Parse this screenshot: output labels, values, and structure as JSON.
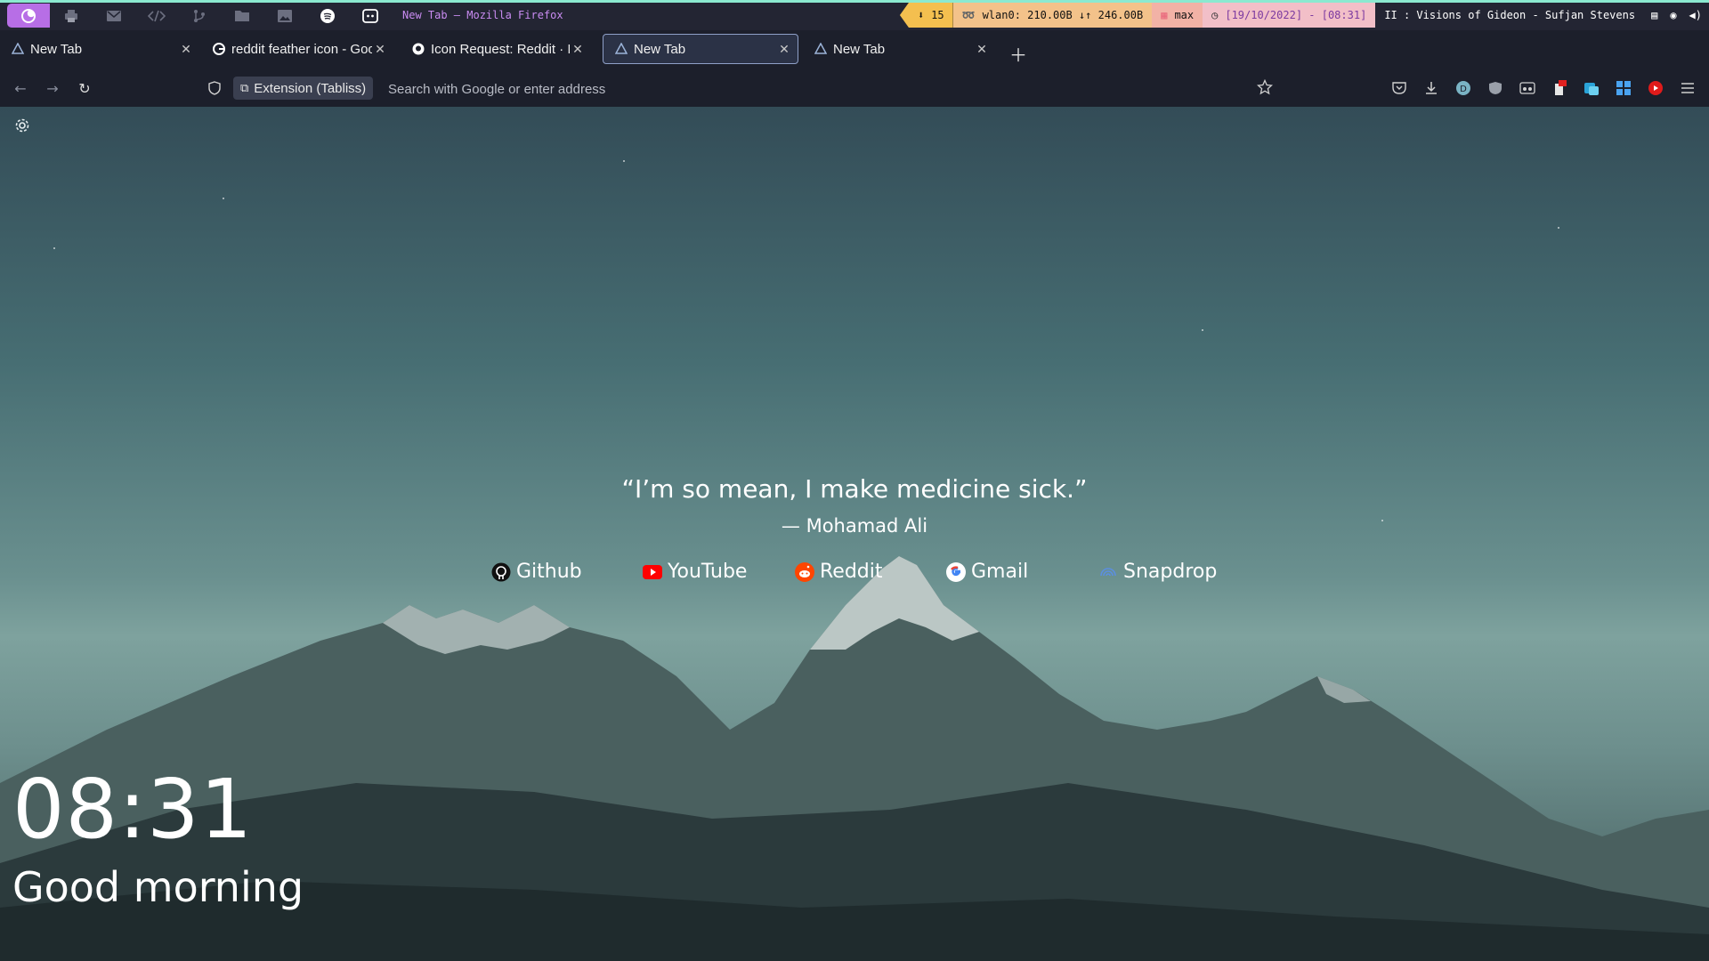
{
  "statusbar": {
    "window_title": "New Tab — Mozilla Firefox",
    "downloads": "15",
    "network": "wlan0: 210.00B ↓↑ 246.00B",
    "volume": "max",
    "datetime": "[19/10/2022] - [08:31]",
    "media": "II : Visions of Gideon - Sufjan Stevens",
    "workspaces": [
      {
        "icon": "firefox-icon"
      },
      {
        "icon": "printer-icon"
      },
      {
        "icon": "mail-icon"
      },
      {
        "icon": "code-icon"
      },
      {
        "icon": "git-branch-icon"
      },
      {
        "icon": "folder-icon"
      },
      {
        "icon": "image-icon"
      },
      {
        "icon": "spotify-icon"
      },
      {
        "icon": "discord-icon"
      }
    ]
  },
  "tabs": [
    {
      "label": "New Tab",
      "icon": "tabliss-icon",
      "selected": false
    },
    {
      "label": "reddit feather icon - Google Search",
      "icon": "google-icon",
      "selected": false
    },
    {
      "label": "Icon Request: Reddit · Issue",
      "icon": "github-icon",
      "selected": false
    },
    {
      "label": "New Tab",
      "icon": "tabliss-icon",
      "selected": true
    },
    {
      "label": "New Tab",
      "icon": "tabliss-icon",
      "selected": false
    }
  ],
  "navbar": {
    "extension_label": "Extension (Tabliss)",
    "url_placeholder": "Search with Google or enter address"
  },
  "page": {
    "quote": "“I’m so mean, I make medicine sick.”",
    "author": "— Mohamad Ali",
    "links": [
      {
        "label": "Github",
        "icon": "github-icon"
      },
      {
        "label": "YouTube",
        "icon": "youtube-icon"
      },
      {
        "label": "Reddit",
        "icon": "reddit-icon"
      },
      {
        "label": "Gmail",
        "icon": "google-icon"
      },
      {
        "label": "Snapdrop",
        "icon": "snapdrop-icon"
      }
    ],
    "time": "08:31",
    "greeting": "Good morning"
  },
  "colors": {
    "accent": "#b76ee6",
    "bar_top": "#8be9d0",
    "youtube": "#ff0000",
    "reddit": "#ff4500"
  }
}
